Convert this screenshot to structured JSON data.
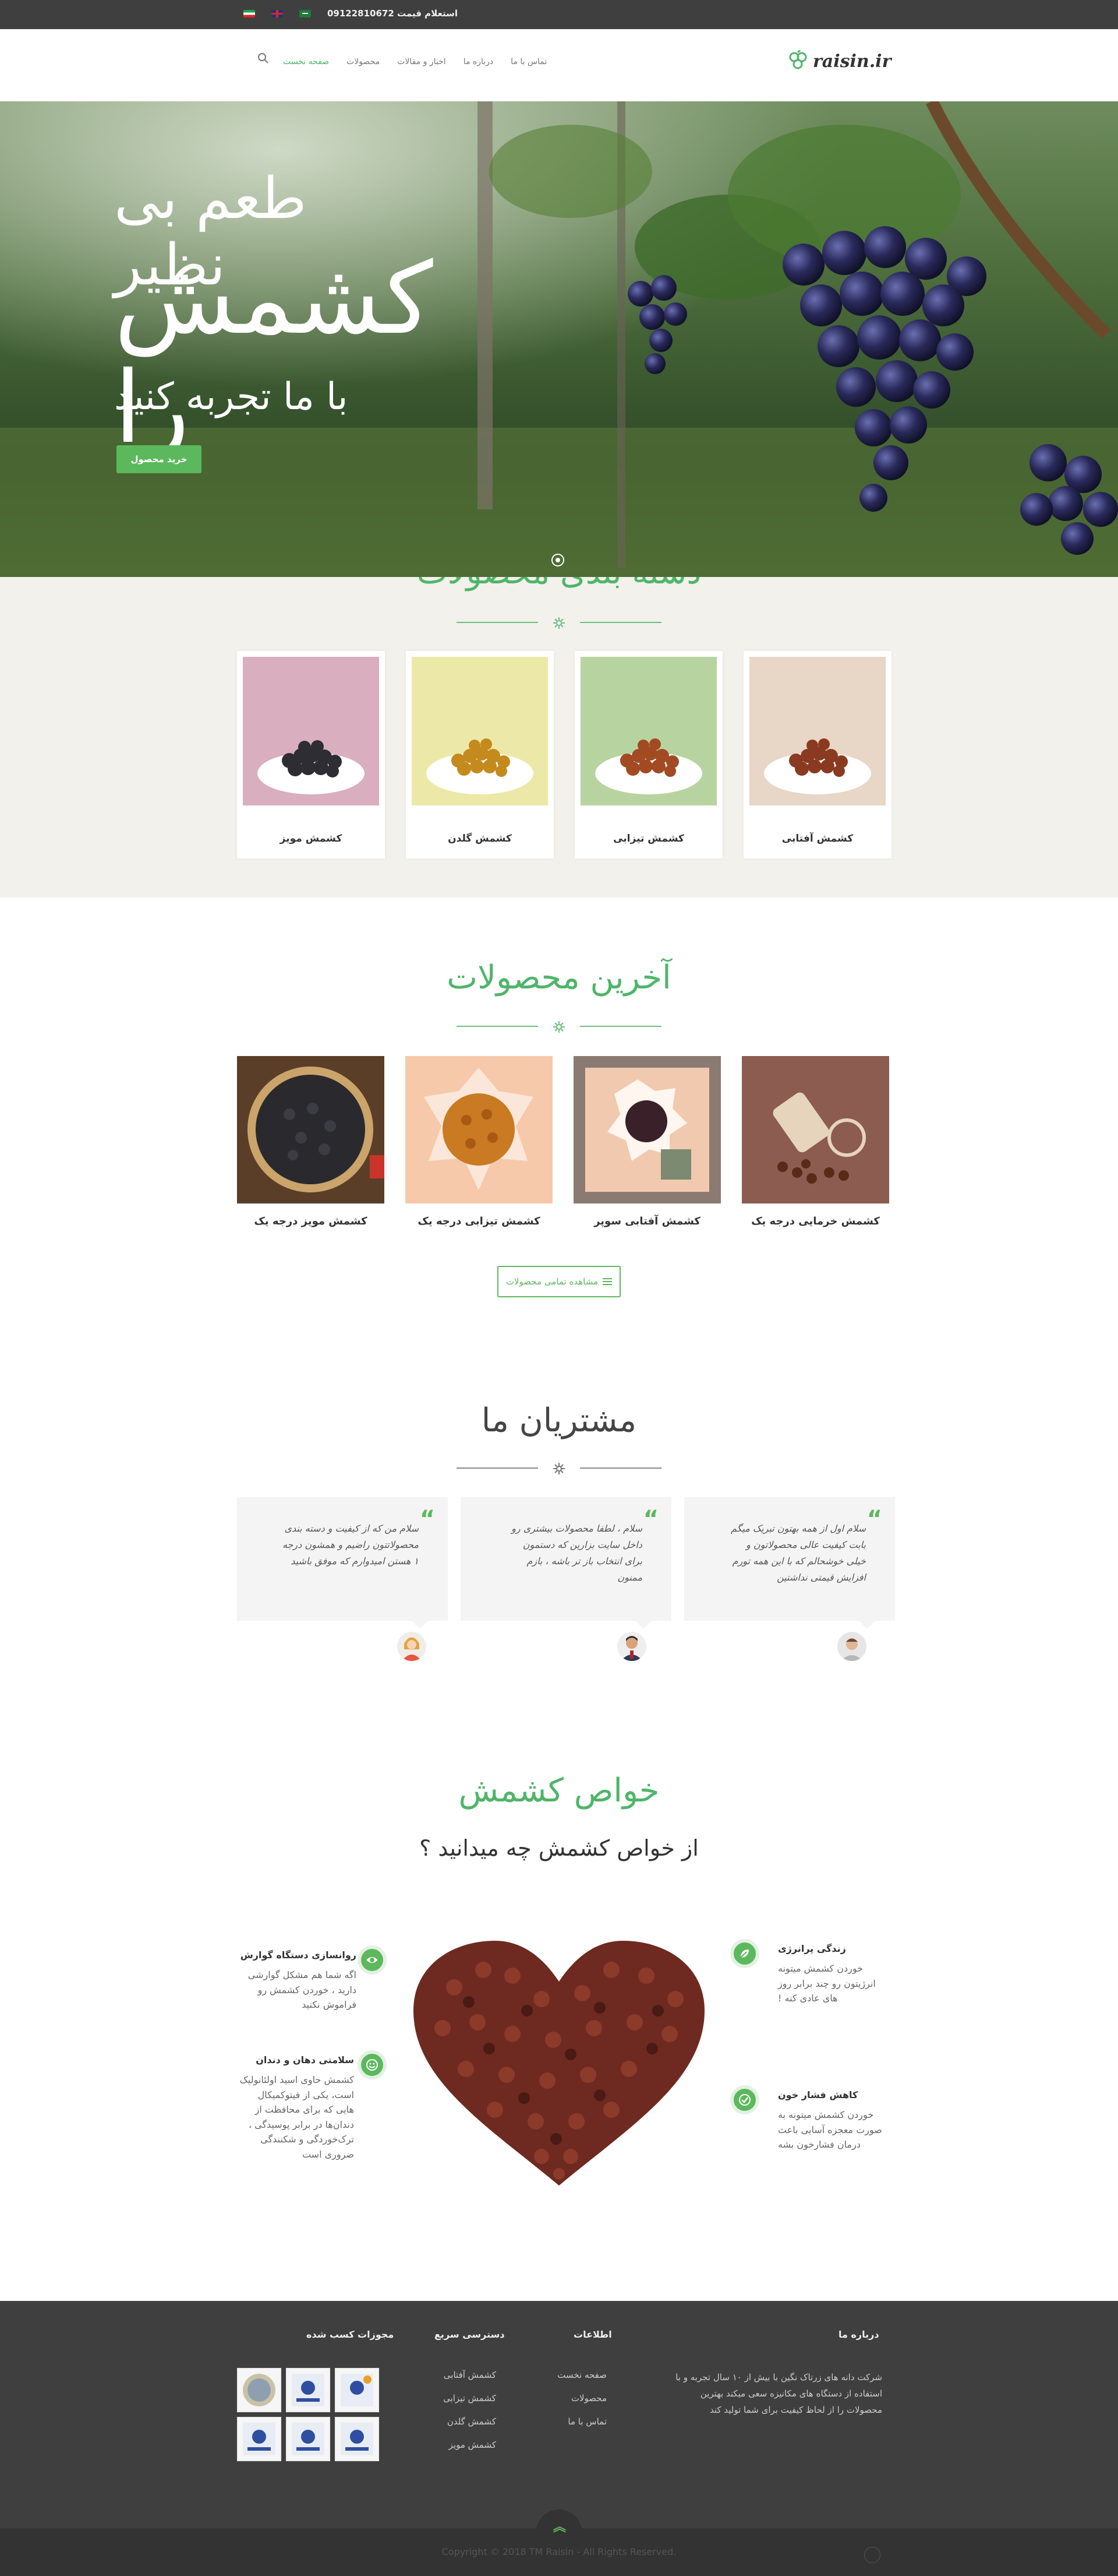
{
  "topbar": {
    "phone": "استعلام قیمت 09122810672",
    "flags": [
      "flag-ir",
      "flag-uk",
      "flag-sa"
    ]
  },
  "header": {
    "logo": "raisin.ir",
    "nav": [
      "صفحه نخست",
      "محصولات",
      "اخبار و مقالات",
      "درباره ما",
      "تماس با ما"
    ],
    "search_icon": "search-icon"
  },
  "hero": {
    "line1": "طعم بی نظیر",
    "line2": "کشمش را",
    "line3": "با ما تجربه کنید",
    "button": "خرید محصول"
  },
  "categories": {
    "title": "دسته بندی محصولات",
    "items": [
      {
        "label": "کشمش آفتابی",
        "bg": "#e8d6c7",
        "color": "#8a3a20"
      },
      {
        "label": "کشمش تیزابی",
        "bg": "#b7d4a0",
        "color": "#a24a22"
      },
      {
        "label": "کشمش گلدن",
        "bg": "#ece9a8",
        "color": "#c48a1e"
      },
      {
        "label": "کشمش مویز",
        "bg": "#d9aebe",
        "color": "#2d2d33"
      }
    ]
  },
  "latest": {
    "title": "آخرین محصولات",
    "items": [
      {
        "label": "کشمش خرمایی درجه یک"
      },
      {
        "label": "کشمش آفتابی سوپر"
      },
      {
        "label": "کشمش تیزابی درجه یک"
      },
      {
        "label": "کشمش مویز درجه یک"
      }
    ],
    "view_all": "مشاهده تمامی محصولات"
  },
  "testimonials": {
    "title": "مشتریان ما",
    "items": [
      {
        "text": "سلام اول از همه بهتون تبریک میگم بابت کیفیت عالی محصولاتون و خیلی خوشحالم که با این همه تورم افزایش قیمتی نداشتین"
      },
      {
        "text": "سلام ، لطفا محصولات بیشتری رو داخل سایت بزارین که دستمون برای انتخاب باز تر باشه ، بازم ممنون"
      },
      {
        "text": "سلام من که از کیفیت و دسته بندی محصولاتتون راضیم و همشون درجه ۱ هستن امیدوارم که موفق باشید"
      }
    ]
  },
  "properties": {
    "title": "خواص کشمش",
    "subtitle": "از خواص کشمش چه میدانید ؟",
    "items": [
      {
        "title": "زندگی پرانرژی",
        "text": "خوردن کشمش میتونه انرژیتون رو چند برابر روز های عادی کنه !"
      },
      {
        "title": "کاهش فشار خون",
        "text": "خوردن کشمش میتونه به صورت معجزه آسایی باعث درمان فشارخون بشه"
      },
      {
        "title": "روانسازی دستگاه گوارش",
        "text": "اگه شما هم مشکل گوارشی دارید ، خوردن کشمش رو فراموش نکنید"
      },
      {
        "title": "سلامتی دهان و دندان",
        "text": "کشمش حاوی اسید اولئانولیک است، یکی از فیتوکمیکال هایی که برای محافظت از دندان‌ها در برابر پوسیدگی ، ترک‌خوردگی و شکنندگی ضروری است"
      }
    ]
  },
  "footer": {
    "about_title": "درباره ما",
    "about_text": "شرکت دانه های زرتاک نگین با بیش از ۱۰ سال تجربه و با استفاده از دستگاه های مکانیزه سعی میکند بهترین محصولات را از لحاظ کیفیت برای شما تولید کند",
    "info_title": "اطلاعات",
    "info_links": [
      "صفحه نخست",
      "محصولات",
      "تماس با ما"
    ],
    "quick_title": "دسترسی سریع",
    "quick_links": [
      "کشمش آفتابی",
      "کشمش تیزابی",
      "کشمش گلدن",
      "کشمش مویز"
    ],
    "licenses_title": "مجوزات کسب شده",
    "copyright": "Copyright © 2018 TM Raisin - All Rights Reserved."
  },
  "colors": {
    "accent": "#5cb85c",
    "accent_text": "#4fb56a",
    "dark": "#3f3f3f"
  }
}
